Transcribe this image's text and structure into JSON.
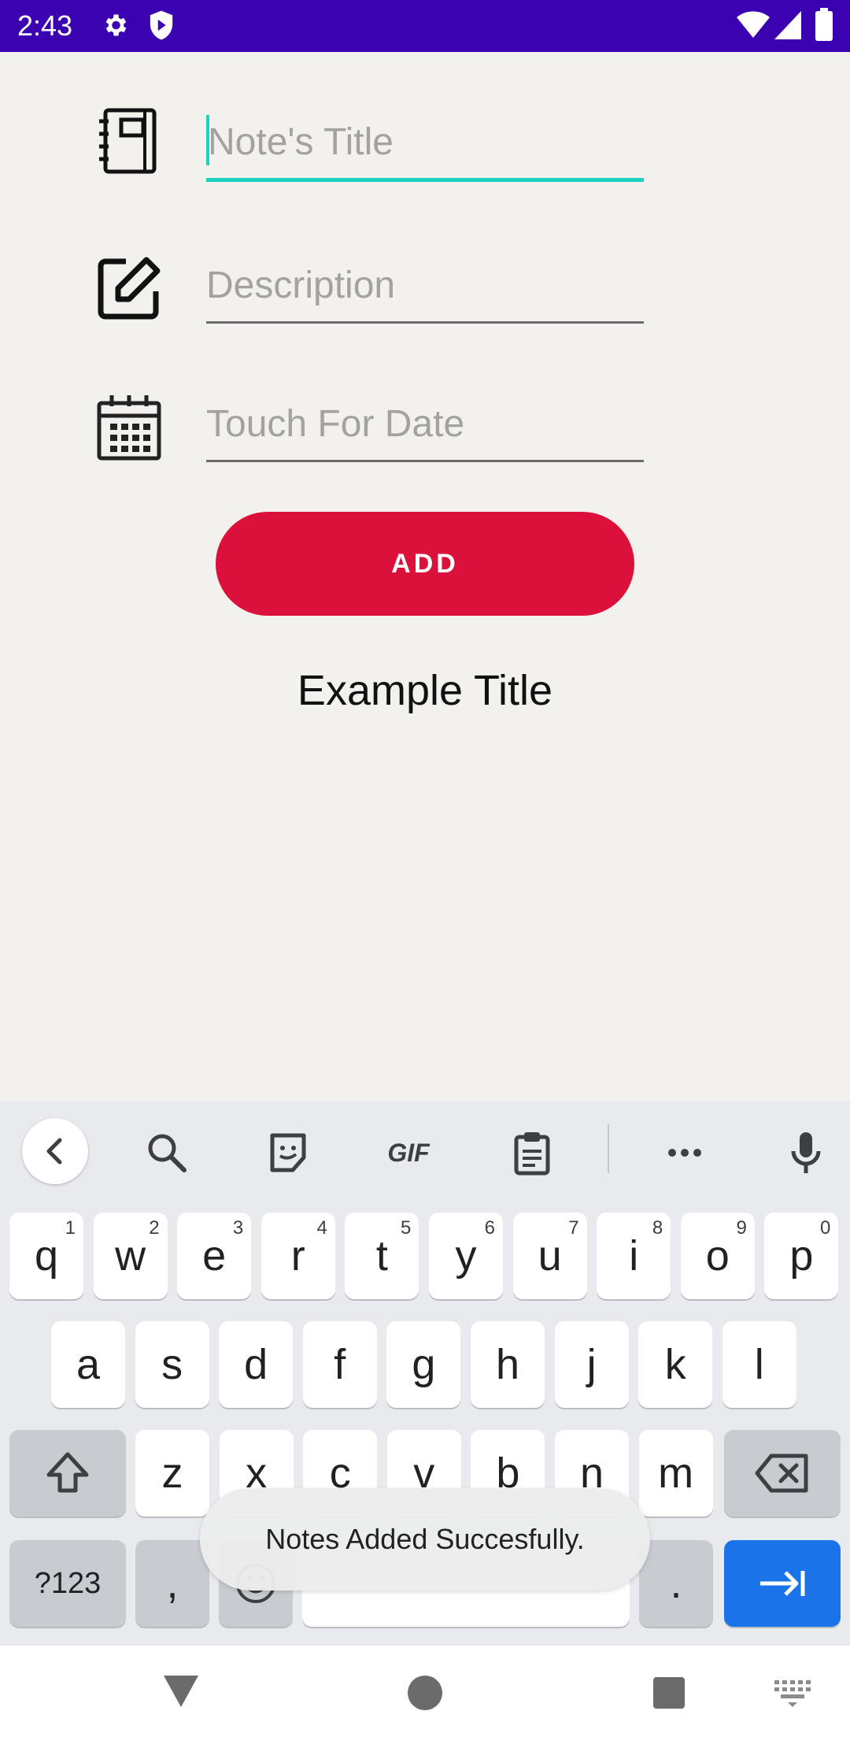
{
  "status_bar": {
    "time": "2:43",
    "icons": [
      "gear-icon",
      "shield-icon",
      "wifi-icon",
      "signal-icon",
      "battery-icon"
    ],
    "background": "#3b02b2"
  },
  "form": {
    "title_field": {
      "placeholder": "Note's Title",
      "value": "",
      "icon": "notebook-icon",
      "focused": true
    },
    "description_field": {
      "placeholder": "Description",
      "value": "",
      "icon": "edit-icon"
    },
    "date_field": {
      "placeholder": "Touch For Date",
      "value": "",
      "icon": "calendar-icon"
    },
    "add_button_label": "ADD",
    "example_title": "Example Title",
    "accent_color": "#19d3be",
    "button_color": "#db113b"
  },
  "keyboard": {
    "toolbar": [
      "back-icon",
      "search-icon",
      "sticker-icon",
      "gif-icon",
      "clipboard-icon",
      "more-icon",
      "mic-icon"
    ],
    "gif_label": "GIF",
    "row1": [
      {
        "key": "q",
        "hint": "1"
      },
      {
        "key": "w",
        "hint": "2"
      },
      {
        "key": "e",
        "hint": "3"
      },
      {
        "key": "r",
        "hint": "4"
      },
      {
        "key": "t",
        "hint": "5"
      },
      {
        "key": "y",
        "hint": "6"
      },
      {
        "key": "u",
        "hint": "7"
      },
      {
        "key": "i",
        "hint": "8"
      },
      {
        "key": "o",
        "hint": "9"
      },
      {
        "key": "p",
        "hint": "0"
      }
    ],
    "row2": [
      "a",
      "s",
      "d",
      "f",
      "g",
      "h",
      "j",
      "k",
      "l"
    ],
    "row3": [
      "z",
      "x",
      "c",
      "v",
      "b",
      "n",
      "m"
    ],
    "symbols_label": "?123",
    "comma_label": ",",
    "period_label": ".",
    "enter_color": "#1a73e8"
  },
  "toast": {
    "message": "Notes Added Succesfully."
  },
  "nav_bar": {
    "icons": [
      "back-icon",
      "home-icon",
      "recents-icon",
      "keyboard-switch-icon"
    ]
  }
}
